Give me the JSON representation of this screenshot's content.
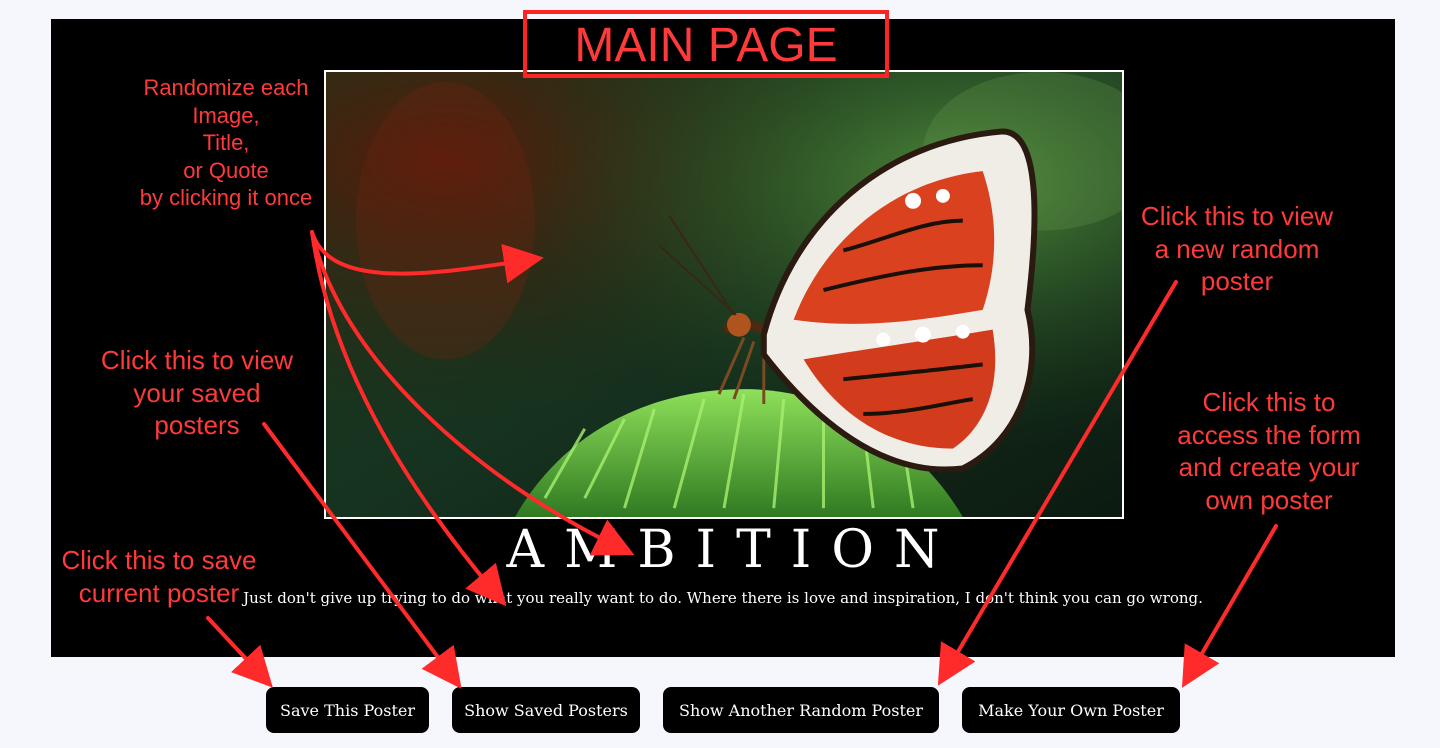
{
  "header": {
    "label": "MAIN PAGE"
  },
  "poster": {
    "title": "AMBITION",
    "quote": "Just don't give up trying to do what you really want to do. Where there is love and inspiration, I don't think you can go wrong.",
    "image_subject": "butterfly-on-fern"
  },
  "buttons": {
    "save": "Save This Poster",
    "show_saved": "Show Saved Posters",
    "random": "Show Another Random Poster",
    "make_own": "Make Your Own Poster"
  },
  "annotations": {
    "randomize": "Randomize each\nImage,\nTitle,\nor Quote\nby clicking it once",
    "saved": "Click this to view\nyour saved\nposters",
    "save": "Click this to save\ncurrent poster",
    "random": "Click this to view\na new random\nposter",
    "form": "Click this to\naccess the form\nand create your\nown poster"
  },
  "colors": {
    "page_bg": "#f6f7fd",
    "poster_bg": "#000000",
    "annotation": "#ff3a3a",
    "button_bg": "#000000",
    "button_text": "#ffffff"
  }
}
